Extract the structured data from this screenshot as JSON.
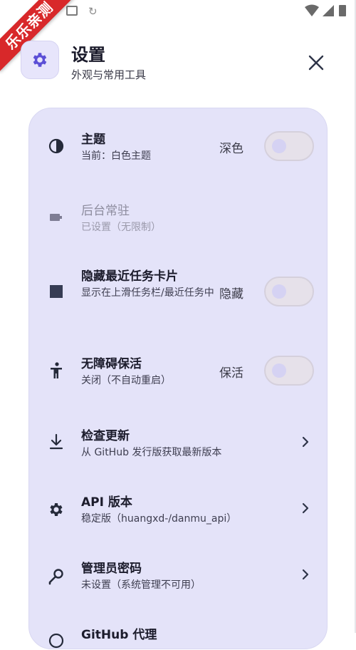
{
  "ribbon": {
    "text": "乐乐亲测"
  },
  "status_bar": {
    "icons": [
      "gallery-icon",
      "sync-icon",
      "wifi-icon",
      "signal-icon",
      "battery-icon"
    ],
    "sync_glyph": "↻"
  },
  "header": {
    "icon": "gear-icon",
    "title": "设置",
    "subtitle": "外观与常用工具",
    "close_icon": "close-icon"
  },
  "settings": [
    {
      "id": "theme",
      "icon": "contrast-icon",
      "title": "主题",
      "subtitle": "当前：白色主题",
      "value": "深色",
      "control": "toggle",
      "checked": false
    },
    {
      "id": "background",
      "icon": "battery-icon",
      "title": "后台常驻",
      "subtitle": "已设置（无限制）",
      "control": "none",
      "disabled": true
    },
    {
      "id": "hide_recents",
      "icon": "square-icon",
      "title": "隐藏最近任务卡片",
      "subtitle": "显示在上滑任务栏/最近任务中",
      "value": "隐藏",
      "control": "toggle",
      "checked": false
    },
    {
      "id": "accessibility",
      "icon": "accessibility-icon",
      "title": "无障碍保活",
      "subtitle": "关闭（不自动重启）",
      "value": "保活",
      "control": "toggle",
      "checked": false
    },
    {
      "id": "update",
      "icon": "download-icon",
      "title": "检查更新",
      "subtitle": "从 GitHub 发行版获取最新版本",
      "control": "chevron"
    },
    {
      "id": "api_version",
      "icon": "gear-icon",
      "title": "API 版本",
      "subtitle": "稳定版（huangxd-/danmu_api）",
      "control": "chevron"
    },
    {
      "id": "admin_password",
      "icon": "key-icon",
      "title": "管理员密码",
      "subtitle": "未设置（系统管理不可用）",
      "control": "chevron"
    },
    {
      "id": "github_proxy",
      "icon": "globe-icon",
      "title": "GitHub 代理",
      "control": "none"
    }
  ],
  "colors": {
    "accent": "#5b4fd6",
    "card_bg": "#e4e3f9",
    "ribbon": "#d8282a",
    "icon": "#3a4055"
  }
}
